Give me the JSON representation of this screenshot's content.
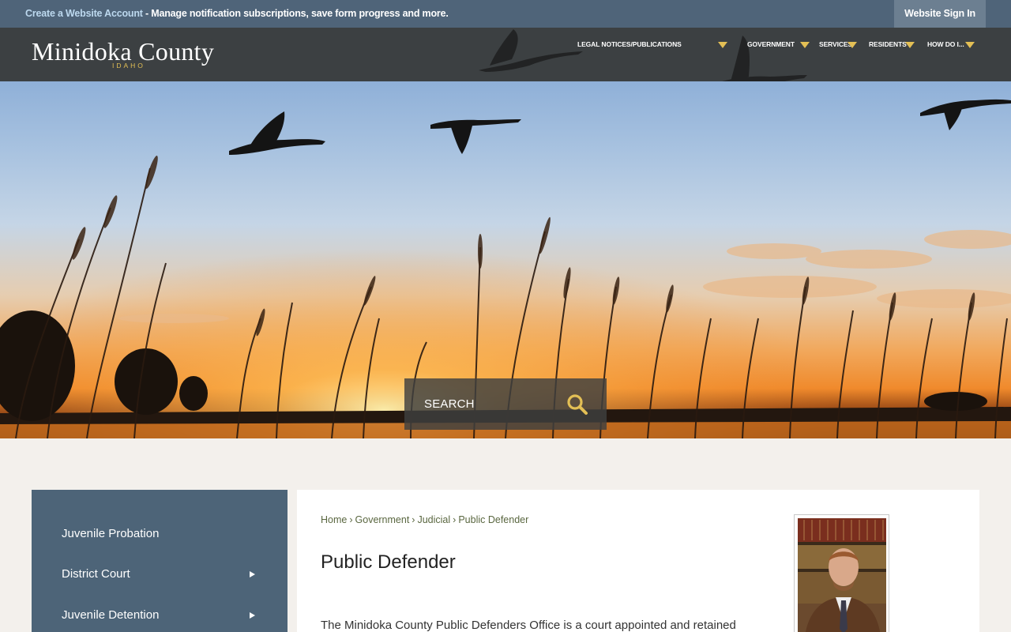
{
  "topbar": {
    "link_text": "Create a Website Account",
    "message": " - Manage notification subscriptions, save form progress and more.",
    "signin_label": "Website Sign In"
  },
  "header": {
    "logo_main": "Minidoka County",
    "logo_sub": "IDAHO",
    "nav": [
      {
        "label": "LEGAL NOTICES/PUBLICATIONS"
      },
      {
        "label": "GOVERNMENT"
      },
      {
        "label": "SERVICES"
      },
      {
        "label": "RESIDENTS"
      },
      {
        "label": "HOW DO I..."
      }
    ]
  },
  "hero": {
    "search_placeholder": "SEARCH"
  },
  "sidebar": {
    "items": [
      {
        "label": "Juvenile Probation",
        "has_submenu": false
      },
      {
        "label": "District Court",
        "has_submenu": true
      },
      {
        "label": "Juvenile Detention",
        "has_submenu": true
      }
    ]
  },
  "main": {
    "breadcrumb": [
      "Home",
      "Government",
      "Judicial",
      "Public Defender"
    ],
    "title": "Public Defender",
    "body_start": "The Minidoka County Public Defenders Office is a court appointed and retained"
  },
  "colors": {
    "topbar": "#4f6479",
    "header": "#3c4042",
    "accent": "#e3bf55",
    "sidebar": "#4d6478",
    "page_bg": "#f3f0ec"
  }
}
